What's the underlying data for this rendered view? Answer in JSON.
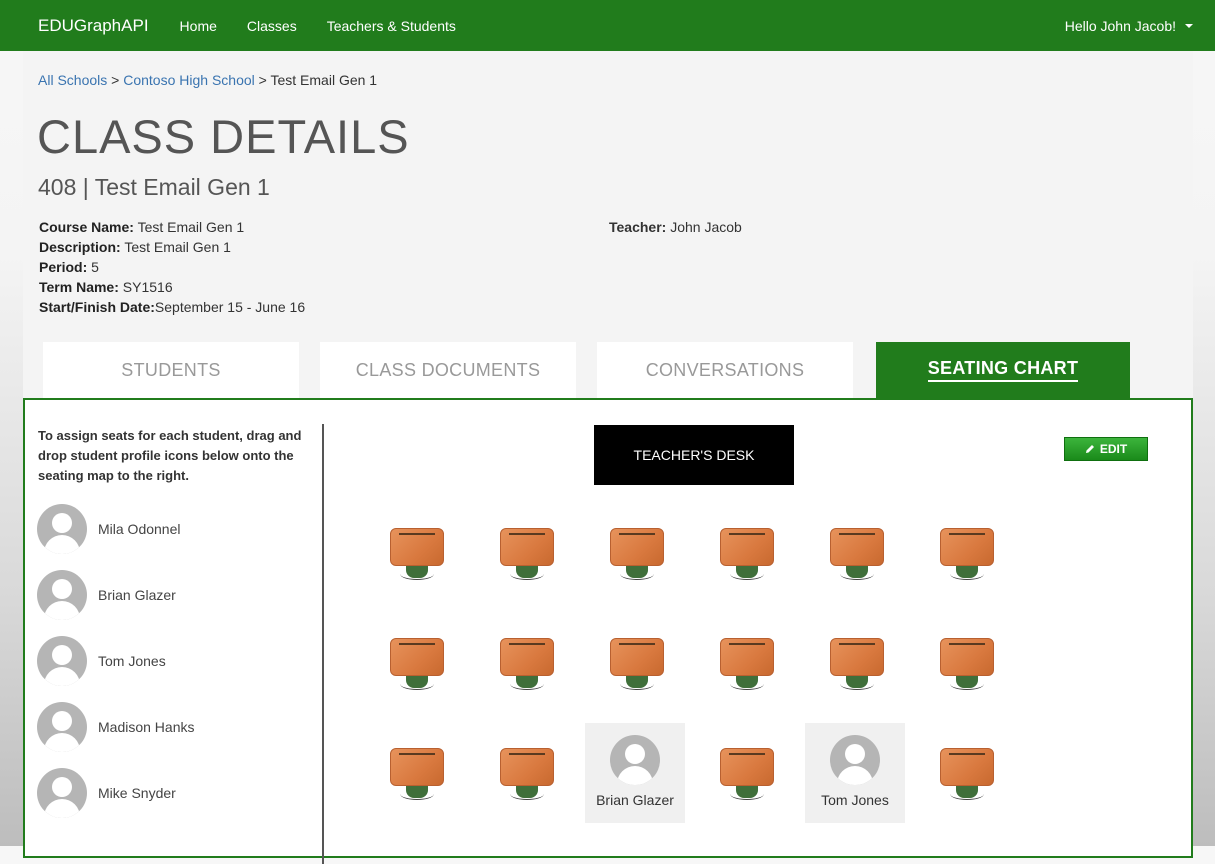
{
  "nav": {
    "brand": "EDUGraphAPI",
    "links": [
      "Home",
      "Classes",
      "Teachers & Students"
    ],
    "user": "Hello John Jacob!"
  },
  "breadcrumb": {
    "all_schools": "All Schools",
    "sep1": ">",
    "school": "Contoso High School",
    "sep2": ">",
    "current": "Test Email Gen 1"
  },
  "page": {
    "title": "CLASS DETAILS",
    "subtitle": "408 | Test Email Gen 1"
  },
  "details": {
    "course_name_label": "Course Name:",
    "course_name": "Test Email Gen 1",
    "description_label": "Description:",
    "description": "Test Email Gen 1",
    "period_label": "Period:",
    "period": "5",
    "term_label": "Term Name:",
    "term": "SY1516",
    "dates_label": "Start/Finish Date:",
    "dates": "September 15 - June 16",
    "teacher_label": "Teacher:",
    "teacher": "John Jacob"
  },
  "tabs": [
    {
      "label": "STUDENTS",
      "active": false
    },
    {
      "label": "CLASS DOCUMENTS",
      "active": false
    },
    {
      "label": "CONVERSATIONS",
      "active": false
    },
    {
      "label": "SEATING CHART",
      "active": true
    }
  ],
  "seating": {
    "instructions": "To assign seats for each student, drag and drop student profile icons below onto the seating map to the right.",
    "students": [
      "Mila Odonnel",
      "Brian Glazer",
      "Tom Jones",
      "Madison Hanks",
      "Mike Snyder"
    ],
    "teacher_desk": "TEACHER'S DESK",
    "edit_label": "EDIT",
    "edit_icon": "pencil-icon",
    "occupied": [
      {
        "row": 3,
        "col": 3,
        "name": "Brian Glazer"
      },
      {
        "row": 3,
        "col": 5,
        "name": "Tom Jones"
      }
    ]
  },
  "colors": {
    "accent": "#217c1c",
    "desk": "#d9793f",
    "link": "#3a74b0"
  }
}
